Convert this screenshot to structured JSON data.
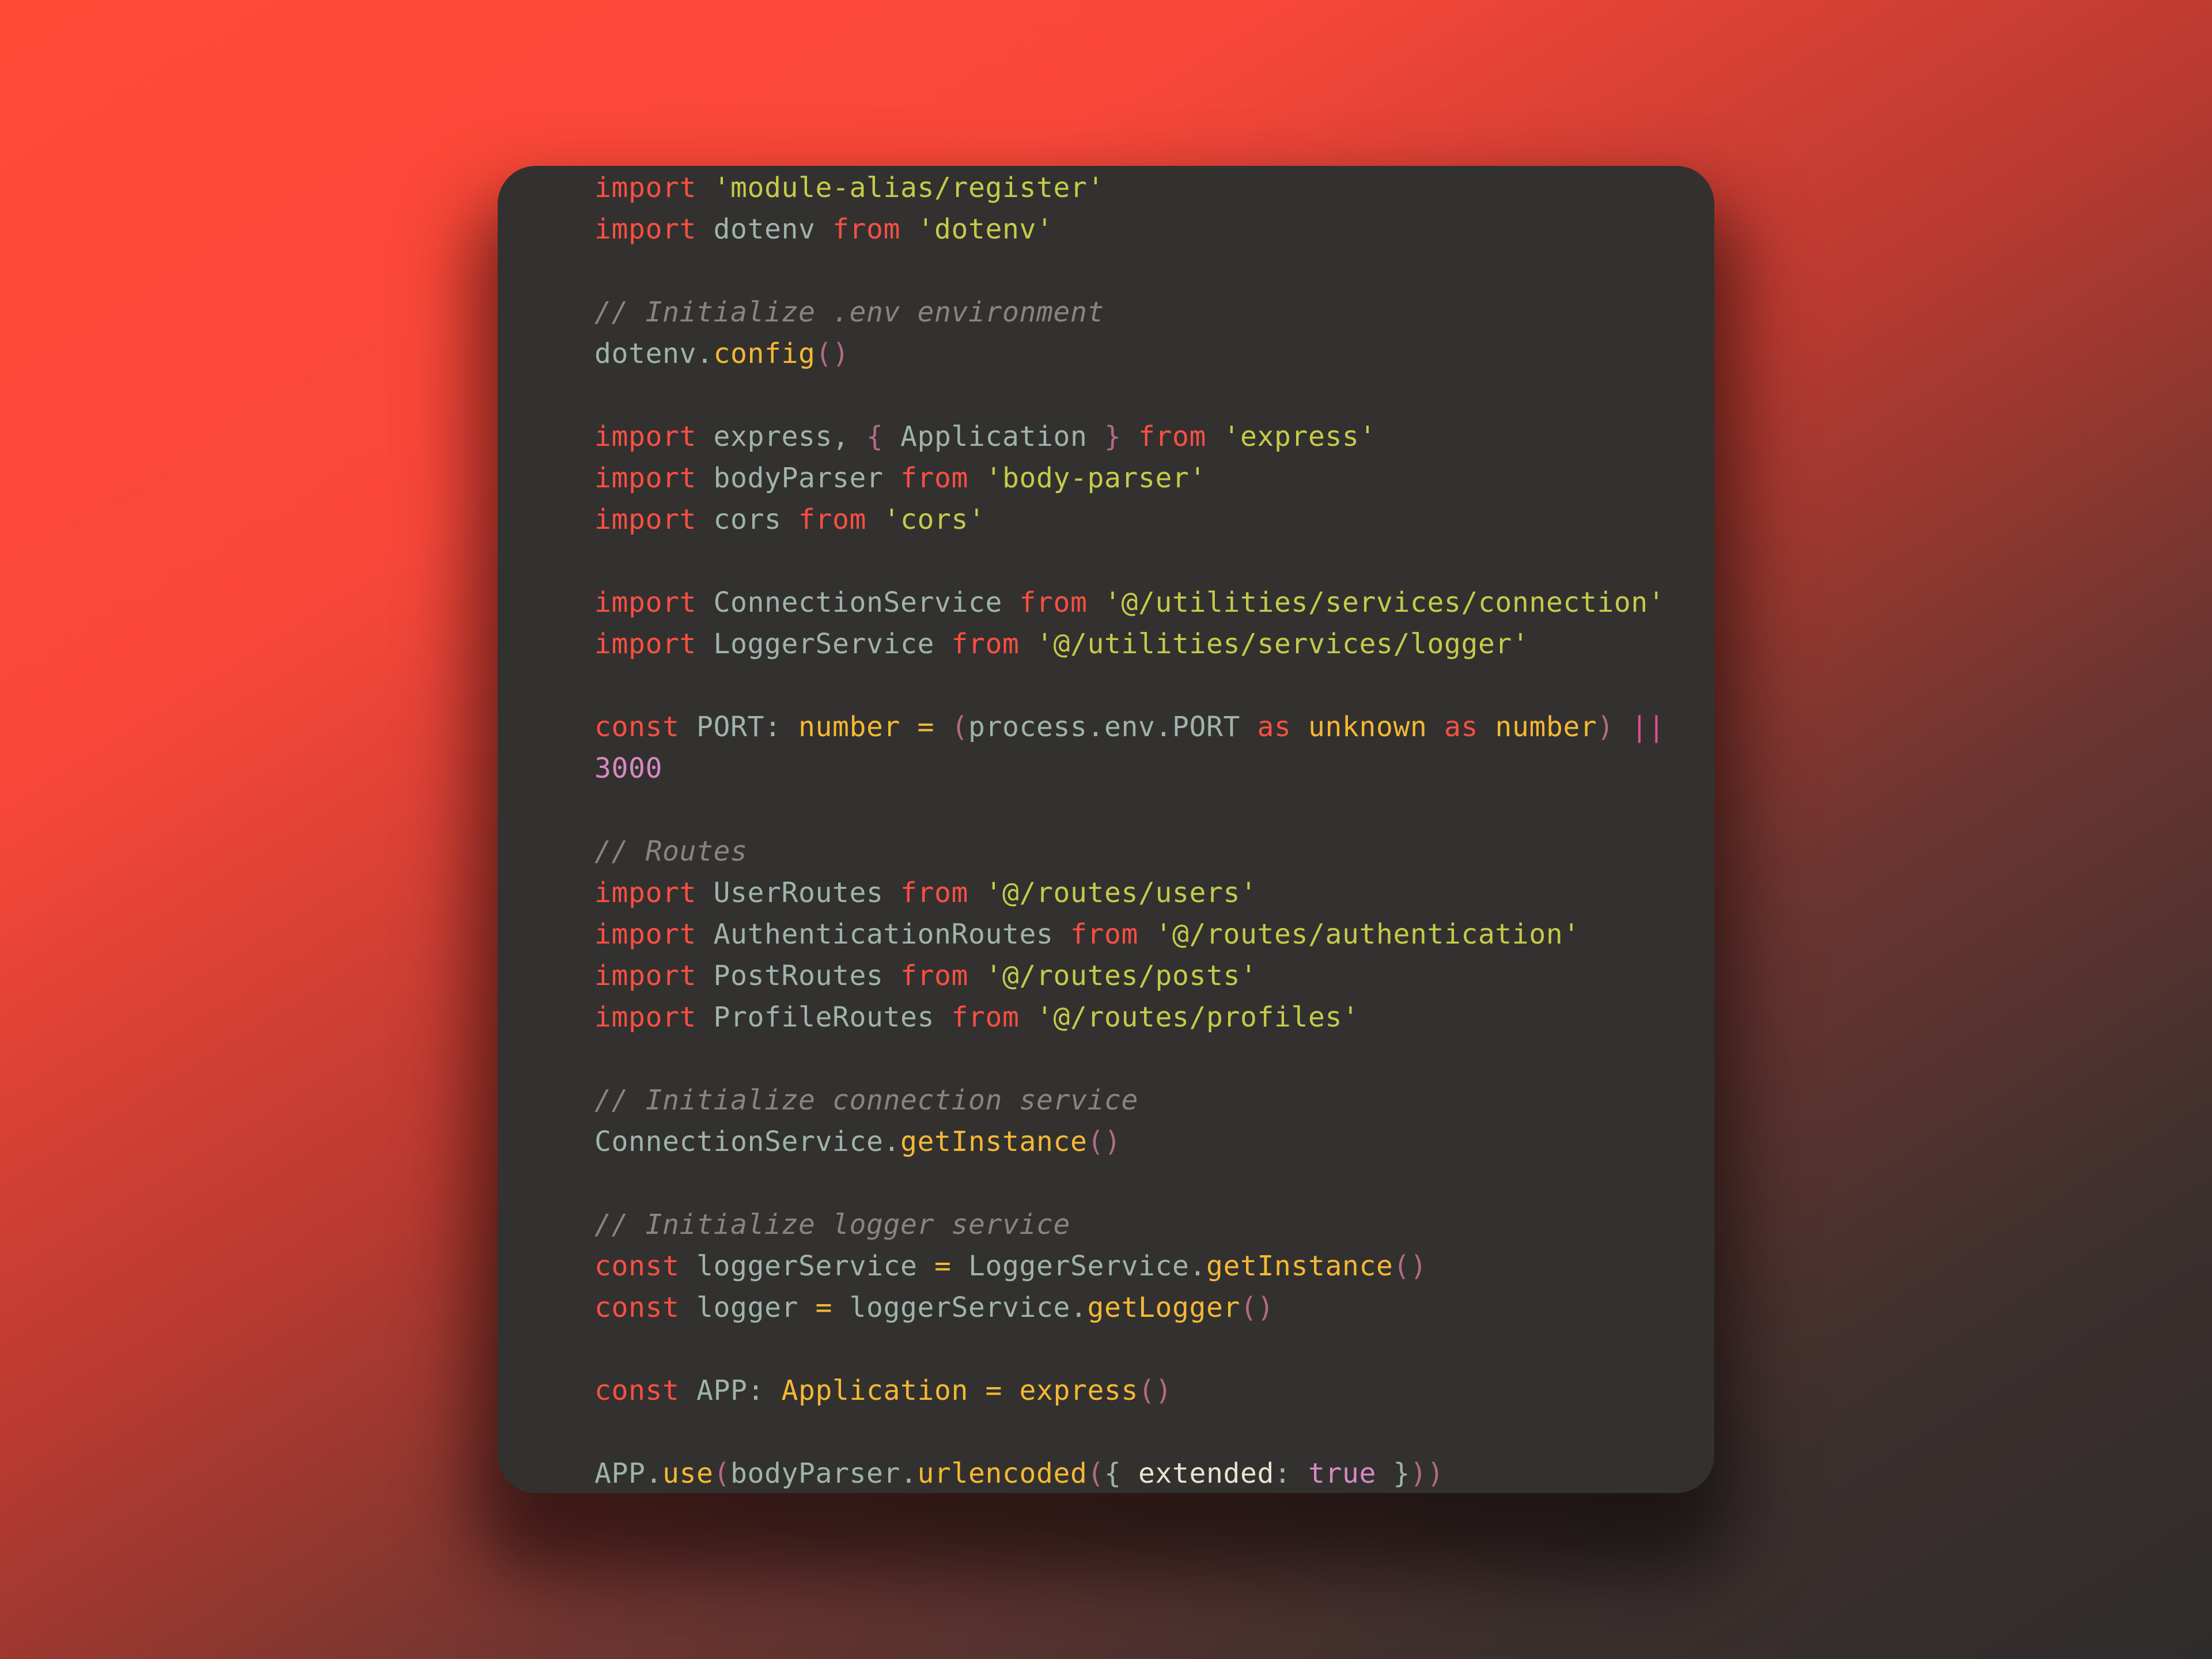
{
  "editor": {
    "language": "typescript",
    "colors": {
      "background_outer_start": "#ff4a35",
      "background_outer_end": "#2e2c2b",
      "panel": "#323130",
      "keyword": "#fb4f42",
      "string": "#c6ca49",
      "comment": "#8a8480",
      "function": "#f6b832",
      "identifier": "#9fb3aa",
      "number": "#d888c2",
      "bracket": "#b56a82"
    },
    "lines": [
      [
        [
          "kw",
          "import"
        ],
        [
          "plain",
          " "
        ],
        [
          "str",
          "'module-alias/register'"
        ]
      ],
      [
        [
          "kw",
          "import"
        ],
        [
          "plain",
          " dotenv "
        ],
        [
          "kw",
          "from"
        ],
        [
          "plain",
          " "
        ],
        [
          "str",
          "'dotenv'"
        ]
      ],
      [],
      [
        [
          "cmt",
          "// Initialize .env environment"
        ]
      ],
      [
        [
          "plain",
          "dotenv."
        ],
        [
          "fn",
          "config"
        ],
        [
          "brk",
          "()"
        ]
      ],
      [],
      [
        [
          "kw",
          "import"
        ],
        [
          "plain",
          " express, "
        ],
        [
          "brk",
          "{"
        ],
        [
          "plain",
          " Application "
        ],
        [
          "brk",
          "}"
        ],
        [
          "plain",
          " "
        ],
        [
          "kw",
          "from"
        ],
        [
          "plain",
          " "
        ],
        [
          "str",
          "'express'"
        ]
      ],
      [
        [
          "kw",
          "import"
        ],
        [
          "plain",
          " bodyParser "
        ],
        [
          "kw",
          "from"
        ],
        [
          "plain",
          " "
        ],
        [
          "str",
          "'body-parser'"
        ]
      ],
      [
        [
          "kw",
          "import"
        ],
        [
          "plain",
          " cors "
        ],
        [
          "kw",
          "from"
        ],
        [
          "plain",
          " "
        ],
        [
          "str",
          "'cors'"
        ]
      ],
      [],
      [
        [
          "kw",
          "import"
        ],
        [
          "plain",
          " ConnectionService "
        ],
        [
          "kw",
          "from"
        ],
        [
          "plain",
          " "
        ],
        [
          "str",
          "'@/utilities/services/connection'"
        ]
      ],
      [
        [
          "kw",
          "import"
        ],
        [
          "plain",
          " LoggerService "
        ],
        [
          "kw",
          "from"
        ],
        [
          "plain",
          " "
        ],
        [
          "str",
          "'@/utilities/services/logger'"
        ]
      ],
      [],
      [
        [
          "kw",
          "const"
        ],
        [
          "plain",
          " PORT: "
        ],
        [
          "type",
          "number"
        ],
        [
          "plain",
          " "
        ],
        [
          "op",
          "="
        ],
        [
          "plain",
          " "
        ],
        [
          "brk",
          "("
        ],
        [
          "plain",
          "process.env.PORT "
        ],
        [
          "kw",
          "as"
        ],
        [
          "plain",
          " "
        ],
        [
          "type",
          "unknown"
        ],
        [
          "plain",
          " "
        ],
        [
          "kw",
          "as"
        ],
        [
          "plain",
          " "
        ],
        [
          "type",
          "number"
        ],
        [
          "brk",
          ")"
        ],
        [
          "plain",
          " "
        ],
        [
          "pipe",
          "||"
        ]
      ],
      [
        [
          "num",
          "3000"
        ]
      ],
      [],
      [
        [
          "cmt",
          "// Routes"
        ]
      ],
      [
        [
          "kw",
          "import"
        ],
        [
          "plain",
          " UserRoutes "
        ],
        [
          "kw",
          "from"
        ],
        [
          "plain",
          " "
        ],
        [
          "str",
          "'@/routes/users'"
        ]
      ],
      [
        [
          "kw",
          "import"
        ],
        [
          "plain",
          " AuthenticationRoutes "
        ],
        [
          "kw",
          "from"
        ],
        [
          "plain",
          " "
        ],
        [
          "str",
          "'@/routes/authentication'"
        ]
      ],
      [
        [
          "kw",
          "import"
        ],
        [
          "plain",
          " PostRoutes "
        ],
        [
          "kw",
          "from"
        ],
        [
          "plain",
          " "
        ],
        [
          "str",
          "'@/routes/posts'"
        ]
      ],
      [
        [
          "kw",
          "import"
        ],
        [
          "plain",
          " ProfileRoutes "
        ],
        [
          "kw",
          "from"
        ],
        [
          "plain",
          " "
        ],
        [
          "str",
          "'@/routes/profiles'"
        ]
      ],
      [],
      [
        [
          "cmt",
          "// Initialize connection service"
        ]
      ],
      [
        [
          "plain",
          "ConnectionService."
        ],
        [
          "fn",
          "getInstance"
        ],
        [
          "brk",
          "()"
        ]
      ],
      [],
      [
        [
          "cmt",
          "// Initialize logger service"
        ]
      ],
      [
        [
          "kw",
          "const"
        ],
        [
          "plain",
          " loggerService "
        ],
        [
          "op",
          "="
        ],
        [
          "plain",
          " LoggerService."
        ],
        [
          "fn",
          "getInstance"
        ],
        [
          "brk",
          "()"
        ]
      ],
      [
        [
          "kw",
          "const"
        ],
        [
          "plain",
          " logger "
        ],
        [
          "op",
          "="
        ],
        [
          "plain",
          " loggerService."
        ],
        [
          "fn",
          "getLogger"
        ],
        [
          "brk",
          "()"
        ]
      ],
      [],
      [
        [
          "kw",
          "const"
        ],
        [
          "plain",
          " APP: "
        ],
        [
          "type",
          "Application"
        ],
        [
          "plain",
          " "
        ],
        [
          "op",
          "="
        ],
        [
          "plain",
          " "
        ],
        [
          "fn",
          "express"
        ],
        [
          "brk",
          "()"
        ]
      ],
      [],
      [
        [
          "plain",
          "APP."
        ],
        [
          "fn",
          "use"
        ],
        [
          "brk",
          "("
        ],
        [
          "plain",
          "bodyParser."
        ],
        [
          "fn",
          "urlencoded"
        ],
        [
          "brk",
          "("
        ],
        [
          "plain",
          "{ "
        ],
        [
          "prop",
          "extended"
        ],
        [
          "plain",
          ": "
        ],
        [
          "bool",
          "true"
        ],
        [
          "plain",
          " }"
        ],
        [
          "brk",
          "))"
        ]
      ]
    ]
  }
}
